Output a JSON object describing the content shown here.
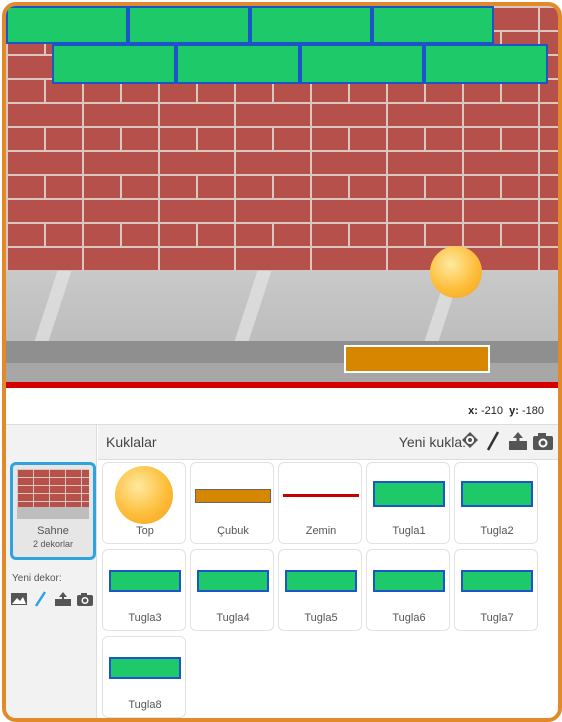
{
  "stage": {
    "coords_x_label": "x:",
    "coords_x_value": "-210",
    "coords_y_label": "y:",
    "coords_y_value": "-180",
    "colors": {
      "brick": "#1ec96a",
      "brick_border": "#1b55c9",
      "paddle": "#d78600",
      "ball": "#fdbe3b",
      "floor_line": "#d40000"
    }
  },
  "sprites_panel": {
    "title": "Kuklalar",
    "new_sprite_label": "Yeni kukla:",
    "new_sprite_icons": [
      "sprite-library-icon",
      "paint-icon",
      "upload-icon",
      "camera-icon"
    ]
  },
  "stage_panel": {
    "name": "Sahne",
    "backdrops": "2 dekorlar",
    "new_backdrop_label": "Yeni dekor:",
    "new_backdrop_icons": [
      "image-icon",
      "paint-icon",
      "upload-icon",
      "camera-icon"
    ]
  },
  "sprites": [
    {
      "name": "Top",
      "kind": "ball"
    },
    {
      "name": "Çubuk",
      "kind": "paddle"
    },
    {
      "name": "Zemin",
      "kind": "line"
    },
    {
      "name": "Tugla1",
      "kind": "brick"
    },
    {
      "name": "Tugla2",
      "kind": "brick"
    },
    {
      "name": "Tugla3",
      "kind": "brick"
    },
    {
      "name": "Tugla4",
      "kind": "brick"
    },
    {
      "name": "Tugla5",
      "kind": "brick"
    },
    {
      "name": "Tugla6",
      "kind": "brick"
    },
    {
      "name": "Tugla7",
      "kind": "brick"
    },
    {
      "name": "Tugla8",
      "kind": "brick"
    }
  ]
}
